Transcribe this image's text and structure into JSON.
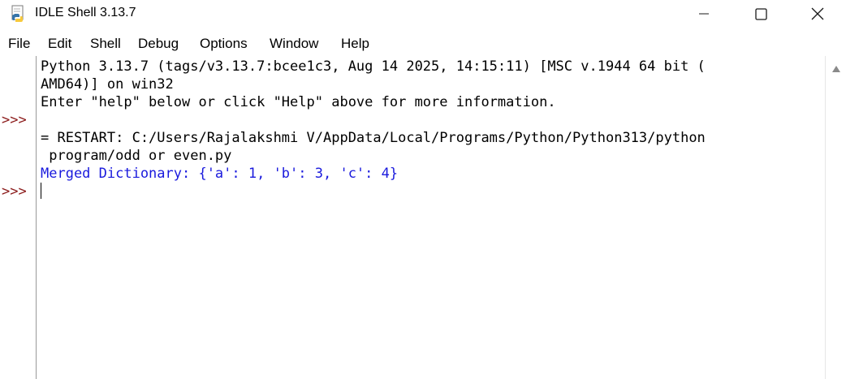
{
  "window": {
    "title": "IDLE Shell 3.13.7",
    "icon": "python-idle-icon",
    "controls": {
      "minimize": "minimize-icon",
      "maximize": "maximize-icon",
      "close": "close-icon"
    }
  },
  "menu": {
    "items": [
      "File",
      "Edit",
      "Shell",
      "Debug",
      "Options",
      "Window",
      "Help"
    ]
  },
  "shell": {
    "prompts": [
      ">>>",
      ">>>"
    ],
    "lines": [
      "Python 3.13.7 (tags/v3.13.7:bcee1c3, Aug 14 2025, 14:15:11) [MSC v.1944 64 bit (",
      "AMD64)] on win32",
      "Enter \"help\" below or click \"Help\" above for more information.",
      "= RESTART: C:/Users/Rajalakshmi V/AppData/Local/Programs/Python/Python313/python",
      " program/odd or even.py",
      "Merged Dictionary: {'a': 1, 'b': 3, 'c': 4}"
    ]
  },
  "colors": {
    "prompt": "#8b1a1a",
    "stdout": "#1a1add",
    "text": "#000000",
    "background": "#ffffff"
  }
}
